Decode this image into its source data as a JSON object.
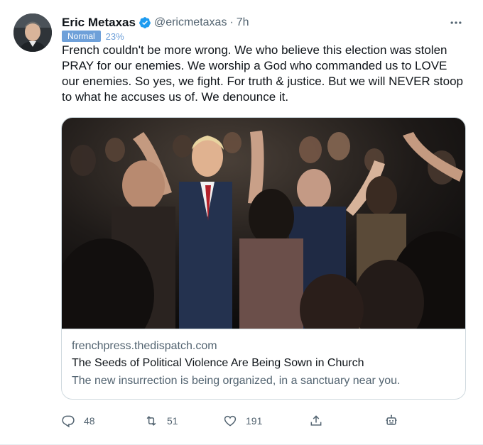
{
  "author": {
    "display_name": "Eric Metaxas",
    "handle": "@ericmetaxas",
    "separator": "·",
    "time": "7h"
  },
  "label": {
    "badge": "Normal",
    "percent": "23%"
  },
  "tweet_text": "French couldn't be more wrong. We who believe this election was stolen PRAY for our enemies. We worship a God who commanded us to LOVE our enemies. So yes, we fight. For truth & justice. But we will NEVER stoop to what he accuses us of. We denounce it.",
  "card": {
    "domain": "frenchpress.thedispatch.com",
    "title": "The Seeds of Political Violence Are Being Sown in Church",
    "description": "The new insurrection is being organized, in a sanctuary near you."
  },
  "actions": {
    "replies": "48",
    "retweets": "51",
    "likes": "191"
  },
  "icons": {
    "verified": "verified-badge-icon",
    "more": "more-options-icon",
    "reply": "reply-icon",
    "retweet": "retweet-icon",
    "like": "heart-icon",
    "share": "share-icon",
    "bot": "bot-icon"
  },
  "colors": {
    "verified_blue": "#1d9bf0",
    "label_blue": "#6ea0d9",
    "secondary_text": "#536471",
    "border": "#cfd9de"
  }
}
